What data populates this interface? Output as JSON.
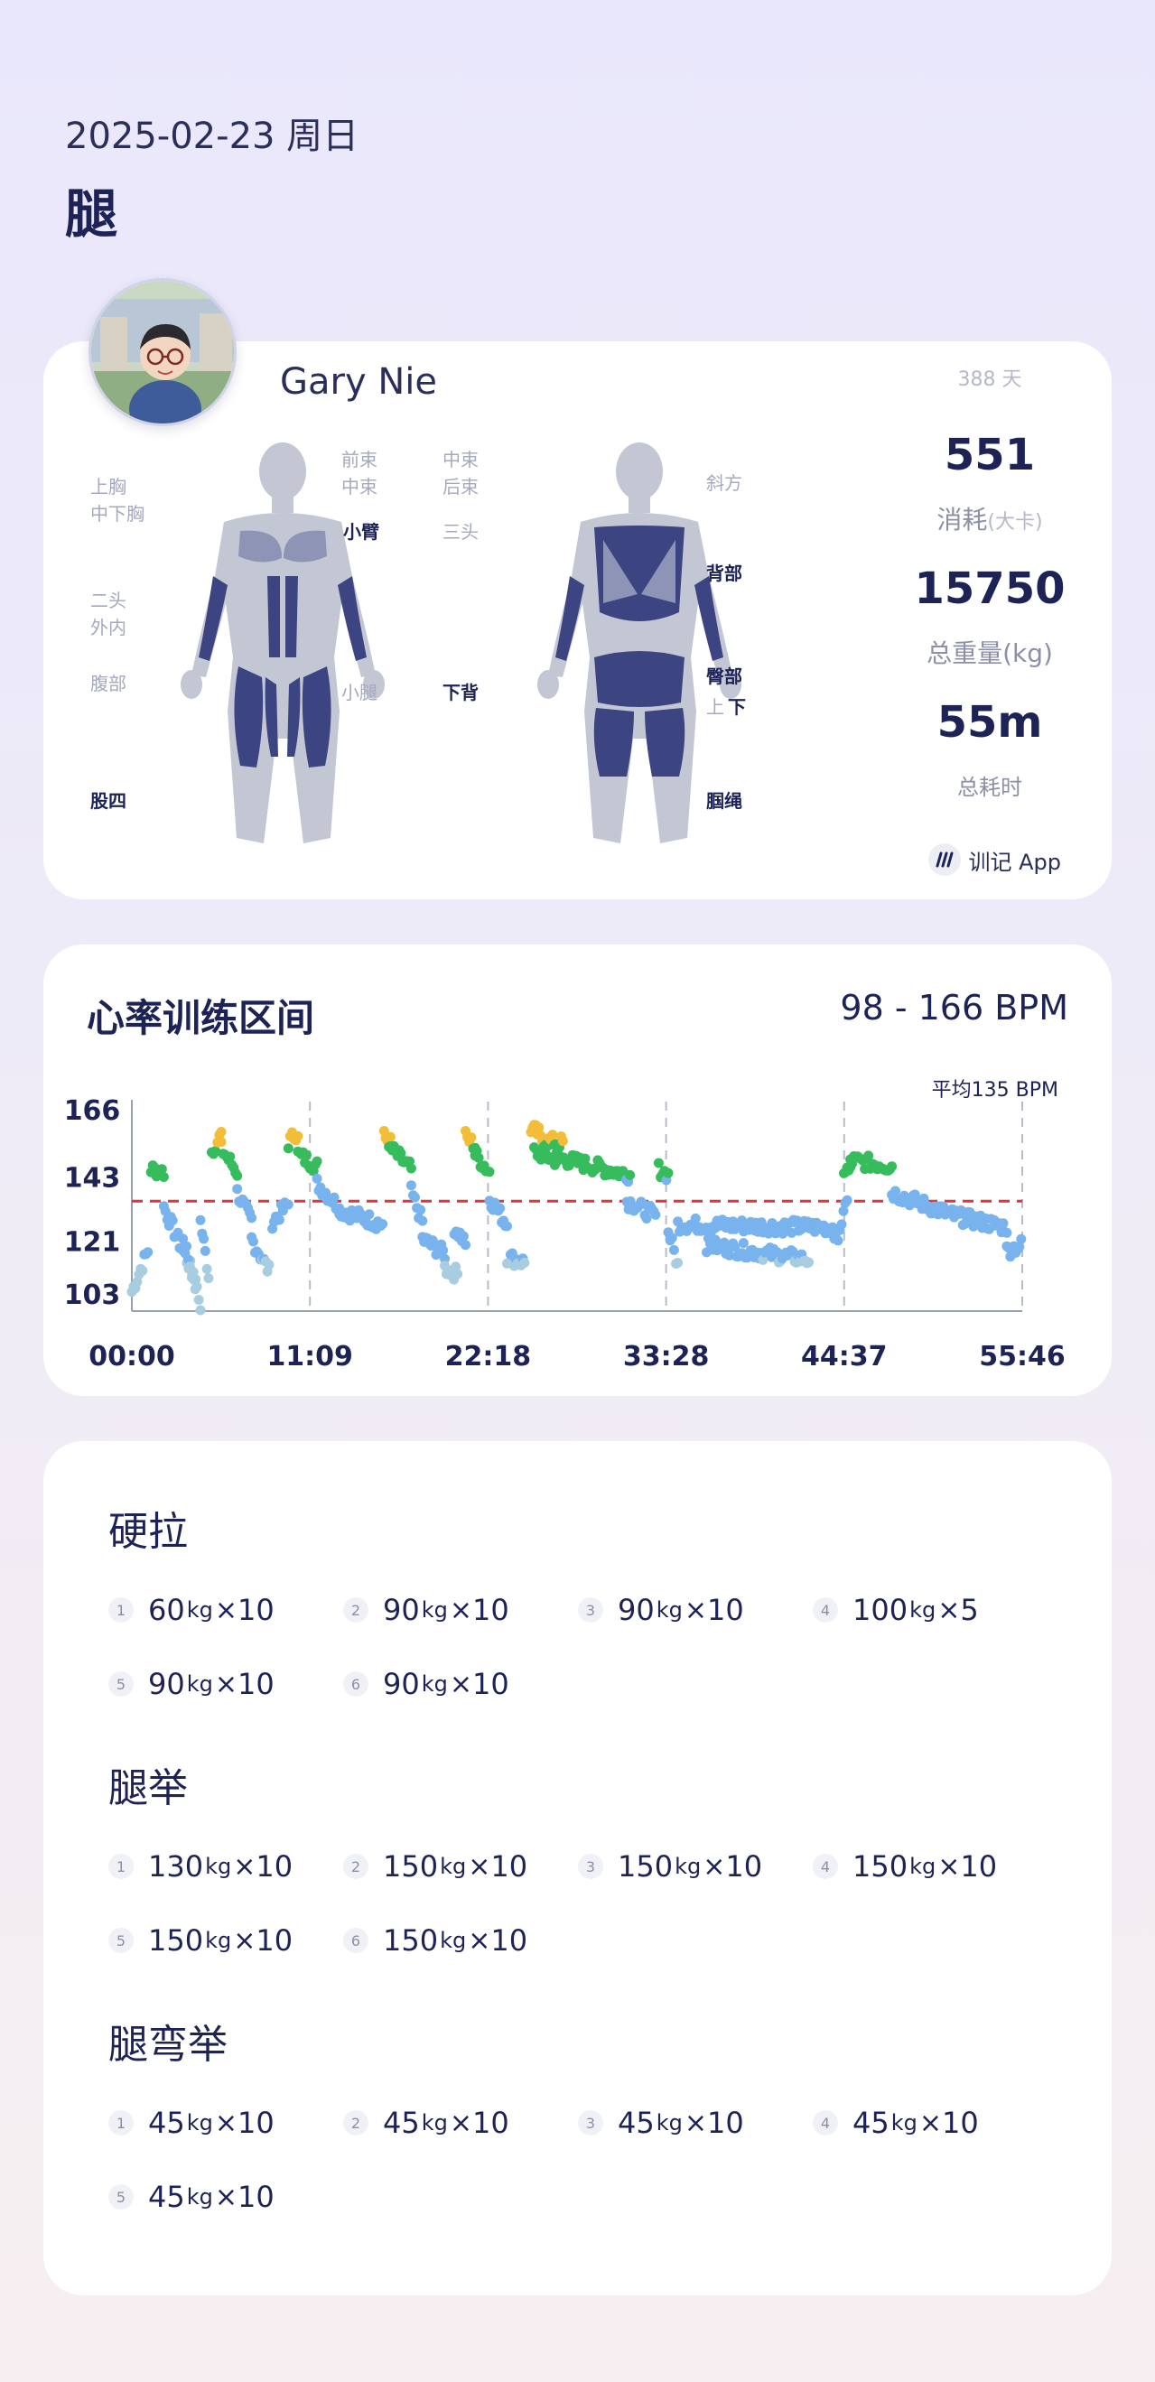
{
  "header": {
    "date": "2025-02-23 周日",
    "title": "腿"
  },
  "profile": {
    "name": "Gary Nie"
  },
  "stats": {
    "days": "388 天",
    "calories": "551",
    "calories_label": "消耗",
    "calories_unit": "(大卡)",
    "weight": "15750",
    "weight_label": "总重量(kg)",
    "duration": "55m",
    "duration_label": "总耗时"
  },
  "brand": {
    "name": "训记 App"
  },
  "muscles": {
    "front": {
      "upper_chest": "上胸",
      "mid_lower_chest": "中下胸",
      "front_delt": "前束",
      "mid_delt": "中束",
      "forearm": "小臂",
      "biceps": "二头",
      "inner": "外内",
      "abs": "腹部",
      "calf": "小腿",
      "quads": "股四"
    },
    "back": {
      "mid_delt": "中束",
      "rear_delt": "后束",
      "triceps": "三头",
      "traps": "斜方",
      "back": "背部",
      "lower_back": "下背",
      "glutes": "臀部",
      "upper": "上",
      "lower": "下",
      "hamstrings": "腘绳"
    }
  },
  "heart_rate": {
    "title": "心率训练区间",
    "range": "98 - 166 BPM",
    "avg_label": "平均135 BPM",
    "colors": {
      "low": "#a9cde0",
      "mid": "#79b3ee",
      "high": "#36bc5d",
      "peak": "#f2be3a",
      "avg_line": "#d63a3a"
    }
  },
  "chart_data": {
    "type": "scatter",
    "title": "心率训练区间",
    "xlabel": "",
    "ylabel": "",
    "y_ticks": [
      "166",
      "143",
      "121",
      "103"
    ],
    "x_ticks": [
      "00:00",
      "11:09",
      "22:18",
      "33:28",
      "44:37",
      "55:46"
    ],
    "ylim": [
      98,
      166
    ],
    "xlim": [
      0,
      55.77
    ],
    "avg": 135,
    "avg_label": "平均135 BPM",
    "grid": "vertical-dashed",
    "segments": [
      {
        "x0": 0.0,
        "x1": 1.0,
        "y0": 104,
        "y1": 118
      },
      {
        "x0": 1.2,
        "x1": 2.0,
        "y0": 146,
        "y1": 145
      },
      {
        "x0": 2.0,
        "x1": 4.0,
        "y0": 133,
        "y1": 108
      },
      {
        "x0": 3.2,
        "x1": 4.3,
        "y0": 123,
        "y1": 99
      },
      {
        "x0": 4.3,
        "x1": 4.8,
        "y0": 128,
        "y1": 110
      },
      {
        "x0": 5.0,
        "x1": 5.6,
        "y0": 152,
        "y1": 158
      },
      {
        "x0": 5.6,
        "x1": 6.6,
        "y0": 153,
        "y1": 145
      },
      {
        "x0": 6.6,
        "x1": 7.5,
        "y0": 138,
        "y1": 128
      },
      {
        "x0": 7.5,
        "x1": 8.6,
        "y0": 122,
        "y1": 111
      },
      {
        "x0": 8.8,
        "x1": 9.8,
        "y0": 128,
        "y1": 134
      },
      {
        "x0": 9.8,
        "x1": 10.4,
        "y0": 155,
        "y1": 159
      },
      {
        "x0": 10.4,
        "x1": 11.6,
        "y0": 151,
        "y1": 147
      },
      {
        "x0": 11.6,
        "x1": 13.0,
        "y0": 141,
        "y1": 133
      },
      {
        "x0": 13.0,
        "x1": 15.2,
        "y0": 132,
        "y1": 128
      },
      {
        "x0": 15.2,
        "x1": 15.7,
        "y0": 128,
        "y1": 127
      },
      {
        "x0": 15.8,
        "x1": 16.2,
        "y0": 157,
        "y1": 155
      },
      {
        "x0": 16.2,
        "x1": 17.5,
        "y0": 153,
        "y1": 146
      },
      {
        "x0": 17.5,
        "x1": 18.2,
        "y0": 138,
        "y1": 128
      },
      {
        "x0": 18.2,
        "x1": 19.6,
        "y0": 122,
        "y1": 117
      },
      {
        "x0": 19.6,
        "x1": 20.4,
        "y0": 112,
        "y1": 110
      },
      {
        "x0": 20.2,
        "x1": 20.9,
        "y0": 126,
        "y1": 121
      },
      {
        "x0": 20.9,
        "x1": 21.5,
        "y0": 157,
        "y1": 154
      },
      {
        "x0": 21.5,
        "x1": 22.4,
        "y0": 151,
        "y1": 145
      },
      {
        "x0": 22.4,
        "x1": 23.5,
        "y0": 136,
        "y1": 127
      },
      {
        "x0": 23.5,
        "x1": 24.6,
        "y0": 116,
        "y1": 114
      },
      {
        "x0": 25.0,
        "x1": 25.5,
        "y0": 160,
        "y1": 158
      },
      {
        "x0": 25.6,
        "x1": 27.0,
        "y0": 156,
        "y1": 155
      },
      {
        "x0": 25.2,
        "x1": 26.6,
        "y0": 152,
        "y1": 149
      },
      {
        "x0": 26.6,
        "x1": 31.2,
        "y0": 150,
        "y1": 144
      },
      {
        "x0": 31.0,
        "x1": 32.8,
        "y0": 135,
        "y1": 130
      },
      {
        "x0": 33.0,
        "x1": 33.6,
        "y0": 146,
        "y1": 144
      },
      {
        "x0": 33.6,
        "x1": 34.2,
        "y0": 125,
        "y1": 113
      },
      {
        "x0": 34.2,
        "x1": 44.0,
        "y0": 127,
        "y1": 126
      },
      {
        "x0": 36.0,
        "x1": 42.4,
        "y0": 120,
        "y1": 115
      },
      {
        "x0": 44.0,
        "x1": 44.8,
        "y0": 120,
        "y1": 134
      },
      {
        "x0": 44.6,
        "x1": 45.0,
        "y0": 146,
        "y1": 145
      },
      {
        "x0": 45.0,
        "x1": 47.6,
        "y0": 149,
        "y1": 147
      },
      {
        "x0": 47.6,
        "x1": 51.5,
        "y0": 138,
        "y1": 130
      },
      {
        "x0": 51.5,
        "x1": 54.8,
        "y0": 130,
        "y1": 126
      },
      {
        "x0": 54.8,
        "x1": 55.7,
        "y0": 118,
        "y1": 120
      }
    ]
  },
  "exercises": [
    {
      "name": "硬拉",
      "sets": [
        {
          "no": "1",
          "weight": "60",
          "unit": "kg",
          "x": "×",
          "reps": "10"
        },
        {
          "no": "2",
          "weight": "90",
          "unit": "kg",
          "x": "×",
          "reps": "10"
        },
        {
          "no": "3",
          "weight": "90",
          "unit": "kg",
          "x": "×",
          "reps": "10"
        },
        {
          "no": "4",
          "weight": "100",
          "unit": "kg",
          "x": "×",
          "reps": "5"
        },
        {
          "no": "5",
          "weight": "90",
          "unit": "kg",
          "x": "×",
          "reps": "10"
        },
        {
          "no": "6",
          "weight": "90",
          "unit": "kg",
          "x": "×",
          "reps": "10"
        }
      ]
    },
    {
      "name": "腿举",
      "sets": [
        {
          "no": "1",
          "weight": "130",
          "unit": "kg",
          "x": "×",
          "reps": "10"
        },
        {
          "no": "2",
          "weight": "150",
          "unit": "kg",
          "x": "×",
          "reps": "10"
        },
        {
          "no": "3",
          "weight": "150",
          "unit": "kg",
          "x": "×",
          "reps": "10"
        },
        {
          "no": "4",
          "weight": "150",
          "unit": "kg",
          "x": "×",
          "reps": "10"
        },
        {
          "no": "5",
          "weight": "150",
          "unit": "kg",
          "x": "×",
          "reps": "10"
        },
        {
          "no": "6",
          "weight": "150",
          "unit": "kg",
          "x": "×",
          "reps": "10"
        }
      ]
    },
    {
      "name": "腿弯举",
      "sets": [
        {
          "no": "1",
          "weight": "45",
          "unit": "kg",
          "x": "×",
          "reps": "10"
        },
        {
          "no": "2",
          "weight": "45",
          "unit": "kg",
          "x": "×",
          "reps": "10"
        },
        {
          "no": "3",
          "weight": "45",
          "unit": "kg",
          "x": "×",
          "reps": "10"
        },
        {
          "no": "4",
          "weight": "45",
          "unit": "kg",
          "x": "×",
          "reps": "10"
        },
        {
          "no": "5",
          "weight": "45",
          "unit": "kg",
          "x": "×",
          "reps": "10"
        }
      ]
    }
  ]
}
